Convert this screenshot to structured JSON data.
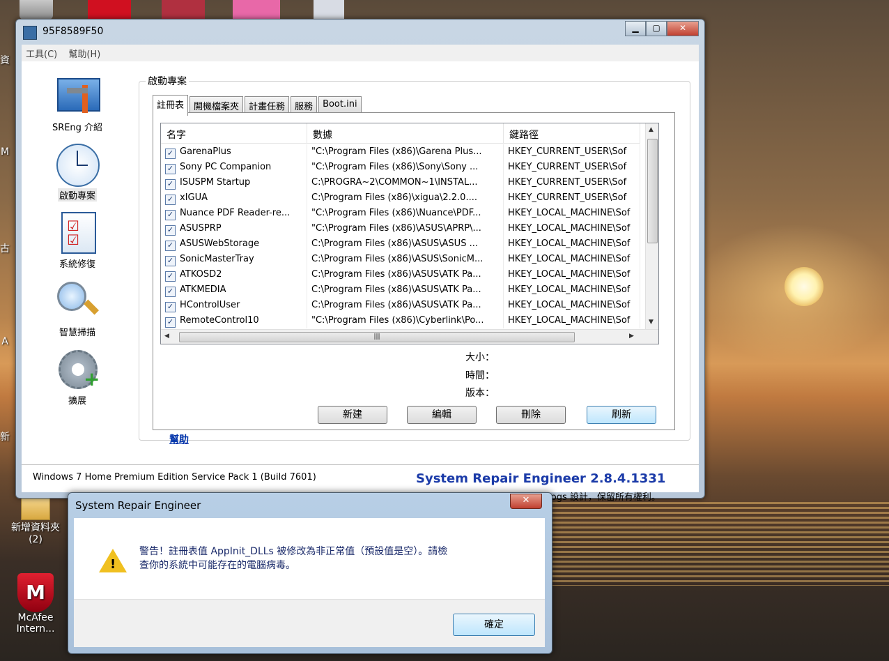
{
  "window": {
    "title": "95F8589F50",
    "menu": [
      "工具(C)",
      "幫助(H)"
    ]
  },
  "sidebar": [
    {
      "label": "SREng 介紹",
      "icon": "tools-icon"
    },
    {
      "label": "啟動專案",
      "icon": "clock-icon"
    },
    {
      "label": "系統修復",
      "icon": "checklist-icon"
    },
    {
      "label": "智慧掃描",
      "icon": "magnifier-icon"
    },
    {
      "label": "擴展",
      "icon": "gear-plus-icon"
    }
  ],
  "group_title": "啟動專案",
  "tabs": [
    "註冊表",
    "開機檔案夾",
    "計畫任務",
    "服務",
    "Boot.ini"
  ],
  "columns": [
    "名字",
    "數據",
    "鍵路徑"
  ],
  "rows": [
    {
      "name": "GarenaPlus",
      "data": "\"C:\\Program Files (x86)\\Garena Plus...",
      "key": "HKEY_CURRENT_USER\\Sof"
    },
    {
      "name": "Sony PC Companion",
      "data": "\"C:\\Program Files (x86)\\Sony\\Sony ...",
      "key": "HKEY_CURRENT_USER\\Sof"
    },
    {
      "name": "ISUSPM Startup",
      "data": "C:\\PROGRA~2\\COMMON~1\\INSTAL...",
      "key": "HKEY_CURRENT_USER\\Sof"
    },
    {
      "name": "xIGUA",
      "data": "C:\\Program Files (x86)\\xigua\\2.2.0....",
      "key": "HKEY_CURRENT_USER\\Sof"
    },
    {
      "name": "Nuance PDF Reader-re...",
      "data": "\"C:\\Program Files (x86)\\Nuance\\PDF...",
      "key": "HKEY_LOCAL_MACHINE\\Sof"
    },
    {
      "name": "ASUSPRP",
      "data": "\"C:\\Program Files (x86)\\ASUS\\APRP\\...",
      "key": "HKEY_LOCAL_MACHINE\\Sof"
    },
    {
      "name": "ASUSWebStorage",
      "data": "C:\\Program Files (x86)\\ASUS\\ASUS ...",
      "key": "HKEY_LOCAL_MACHINE\\Sof"
    },
    {
      "name": "SonicMasterTray",
      "data": "C:\\Program Files (x86)\\ASUS\\SonicM...",
      "key": "HKEY_LOCAL_MACHINE\\Sof"
    },
    {
      "name": "ATKOSD2",
      "data": "C:\\Program Files (x86)\\ASUS\\ATK Pa...",
      "key": "HKEY_LOCAL_MACHINE\\Sof"
    },
    {
      "name": "ATKMEDIA",
      "data": "C:\\Program Files (x86)\\ASUS\\ATK Pa...",
      "key": "HKEY_LOCAL_MACHINE\\Sof"
    },
    {
      "name": "HControlUser",
      "data": "C:\\Program Files (x86)\\ASUS\\ATK Pa...",
      "key": "HKEY_LOCAL_MACHINE\\Sof"
    },
    {
      "name": "RemoteControl10",
      "data": "\"C:\\Program Files (x86)\\Cyberlink\\Po...",
      "key": "HKEY_LOCAL_MACHINE\\Sof"
    }
  ],
  "info_labels": {
    "size": "大小：",
    "time": "時間：",
    "version": "版本："
  },
  "buttons": {
    "help": "幫助",
    "new": "新建",
    "edit": "編輯",
    "delete": "刪除",
    "refresh": "刷新"
  },
  "status": {
    "os": "Windows 7 Home Premium Edition Service Pack 1 (Build 7601)",
    "product": "System Repair Engineer 2.8.4.1331",
    "copyright": "Smallfrogs 設計，保留所有權利。"
  },
  "dialog": {
    "title": "System Repair Engineer",
    "message_line1": "警告！註冊表值 AppInit_DLLs 被修改為非正常值（預設值是空）。請檢",
    "message_line2": "查你的系統中可能存在的電腦病毒。",
    "ok": "確定"
  },
  "desktop": {
    "folder_label_1": "新增資料夾",
    "folder_label_2": "(2)",
    "mcafee_label_1": "McAfee",
    "mcafee_label_2": "Intern...",
    "edge_chars": [
      "資",
      "M",
      "古",
      "A",
      "新"
    ]
  },
  "colors": {
    "brand": "#1a3aa8",
    "link": "#0033aa"
  }
}
